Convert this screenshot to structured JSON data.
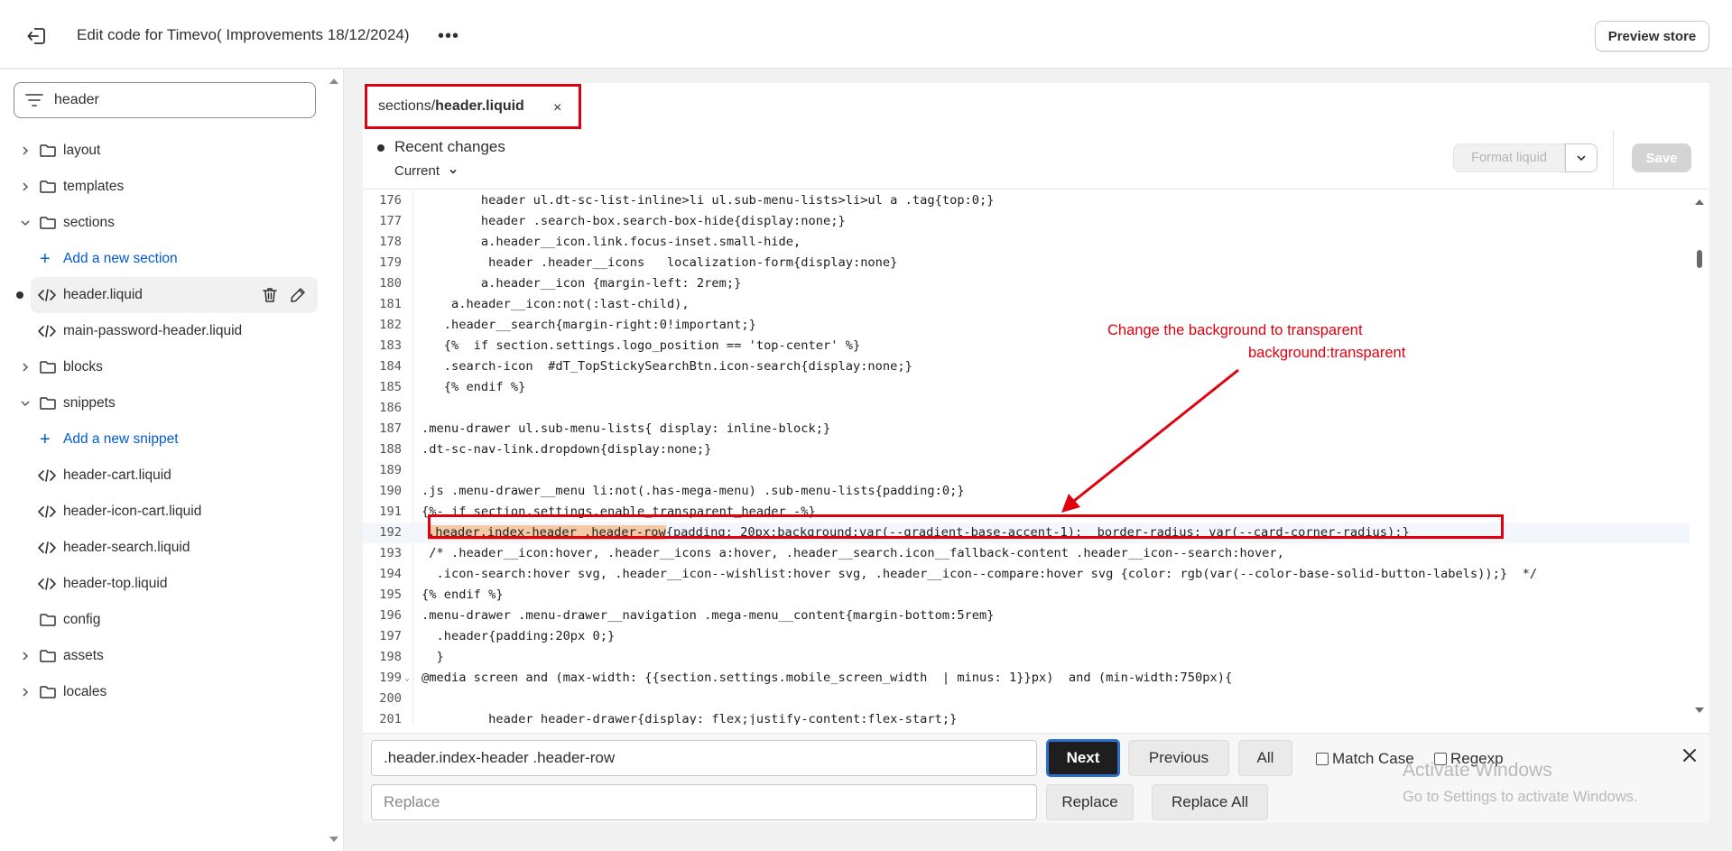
{
  "header": {
    "title": "Edit code for Timevo( Improvements 18/12/2024)",
    "more_label": "•••",
    "preview_label": "Preview store"
  },
  "sidebar": {
    "search_value": "header",
    "items": [
      {
        "type": "folder",
        "label": "layout",
        "expanded": false
      },
      {
        "type": "folder",
        "label": "templates",
        "expanded": false
      },
      {
        "type": "folder",
        "label": "sections",
        "expanded": true
      },
      {
        "type": "add",
        "label": "Add a new section"
      },
      {
        "type": "file",
        "label": "header.liquid",
        "active": true
      },
      {
        "type": "file",
        "label": "main-password-header.liquid"
      },
      {
        "type": "folder",
        "label": "blocks",
        "expanded": false
      },
      {
        "type": "folder",
        "label": "snippets",
        "expanded": true
      },
      {
        "type": "add",
        "label": "Add a new snippet"
      },
      {
        "type": "file",
        "label": "header-cart.liquid"
      },
      {
        "type": "file",
        "label": "header-icon-cart.liquid"
      },
      {
        "type": "file",
        "label": "header-search.liquid"
      },
      {
        "type": "file",
        "label": "header-top.liquid"
      },
      {
        "type": "folder",
        "label": "config",
        "expanded": null
      },
      {
        "type": "folder",
        "label": "assets",
        "expanded": false
      },
      {
        "type": "folder",
        "label": "locales",
        "expanded": false
      }
    ]
  },
  "tab": {
    "path": "sections/",
    "file": "header.liquid",
    "close": "×"
  },
  "toolbar": {
    "recent_title": "Recent changes",
    "current_label": "Current",
    "format_label": "Format liquid",
    "save_label": "Save"
  },
  "code": {
    "current_line": "192",
    "lines": [
      {
        "n": "176",
        "t": "        header ul.dt-sc-list-inline>li ul.sub-menu-lists>li>ul a .tag{top:0;}"
      },
      {
        "n": "177",
        "t": "        header .search-box.search-box-hide{display:none;}"
      },
      {
        "n": "178",
        "t": "        a.header__icon.link.focus-inset.small-hide,"
      },
      {
        "n": "179",
        "t": "         header .header__icons   localization-form{display:none}"
      },
      {
        "n": "180",
        "t": "        a.header__icon {margin-left: 2rem;}"
      },
      {
        "n": "181",
        "t": "    a.header__icon:not(:last-child),"
      },
      {
        "n": "182",
        "t": "   .header__search{margin-right:0!important;}"
      },
      {
        "n": "183",
        "t": "   {%  if section.settings.logo_position == 'top-center' %}"
      },
      {
        "n": "184",
        "t": "   .search-icon  #dT_TopStickySearchBtn.icon-search{display:none;}"
      },
      {
        "n": "185",
        "t": "   {% endif %}"
      },
      {
        "n": "186",
        "t": ""
      },
      {
        "n": "187",
        "t": ".menu-drawer ul.sub-menu-lists{ display: inline-block;}"
      },
      {
        "n": "188",
        "t": ".dt-sc-nav-link.dropdown{display:none;}"
      },
      {
        "n": "189",
        "t": ""
      },
      {
        "n": "190",
        "t": ".js .menu-drawer__menu li:not(.has-mega-menu) .sub-menu-lists{padding:0;}"
      },
      {
        "n": "191",
        "t": "{%- if section.settings.enable_transparent_header -%}"
      },
      {
        "n": "192",
        "t": ".header.index-header .header-row",
        "rest": "{padding: 20px;background:var(--gradient-base-accent-1);  border-radius: var(--card-corner-radius);}"
      },
      {
        "n": "193",
        "t": " /* .header__icon:hover, .header__icons a:hover, .header__search.icon__fallback-content .header__icon--search:hover,"
      },
      {
        "n": "194",
        "t": "  .icon-search:hover svg, .header__icon--wishlist:hover svg, .header__icon--compare:hover svg {color: rgb(var(--color-base-solid-button-labels));}  */"
      },
      {
        "n": "195",
        "t": "{% endif %}"
      },
      {
        "n": "196",
        "t": ".menu-drawer .menu-drawer__navigation .mega-menu__content{margin-bottom:5rem}"
      },
      {
        "n": "197",
        "t": "  .header{padding:20px 0;}"
      },
      {
        "n": "198",
        "t": "  }"
      },
      {
        "n": "199",
        "t": "@media screen and (max-width: {{section.settings.mobile_screen_width  | minus: 1}}px)  and (min-width:750px){",
        "fold": "⌄"
      },
      {
        "n": "200",
        "t": ""
      },
      {
        "n": "201",
        "t": "         header header-drawer{display: flex;justify-content:flex-start;}"
      }
    ]
  },
  "annotation": {
    "line1": "Change the background to transparent",
    "line2": "background:transparent"
  },
  "findbar": {
    "find_value": ".header.index-header .header-row",
    "replace_placeholder": "Replace",
    "next_label": "Next",
    "previous_label": "Previous",
    "all_label": "All",
    "match_case_label": "Match Case",
    "regexp_label": "Regexp",
    "replace_label": "Replace",
    "replace_all_label": "Replace All"
  },
  "watermark": {
    "line1": "Activate Windows",
    "line2": "Go to Settings to activate Windows."
  },
  "colors": {
    "accent_red": "#e0000e",
    "link_blue": "#005bd3"
  }
}
